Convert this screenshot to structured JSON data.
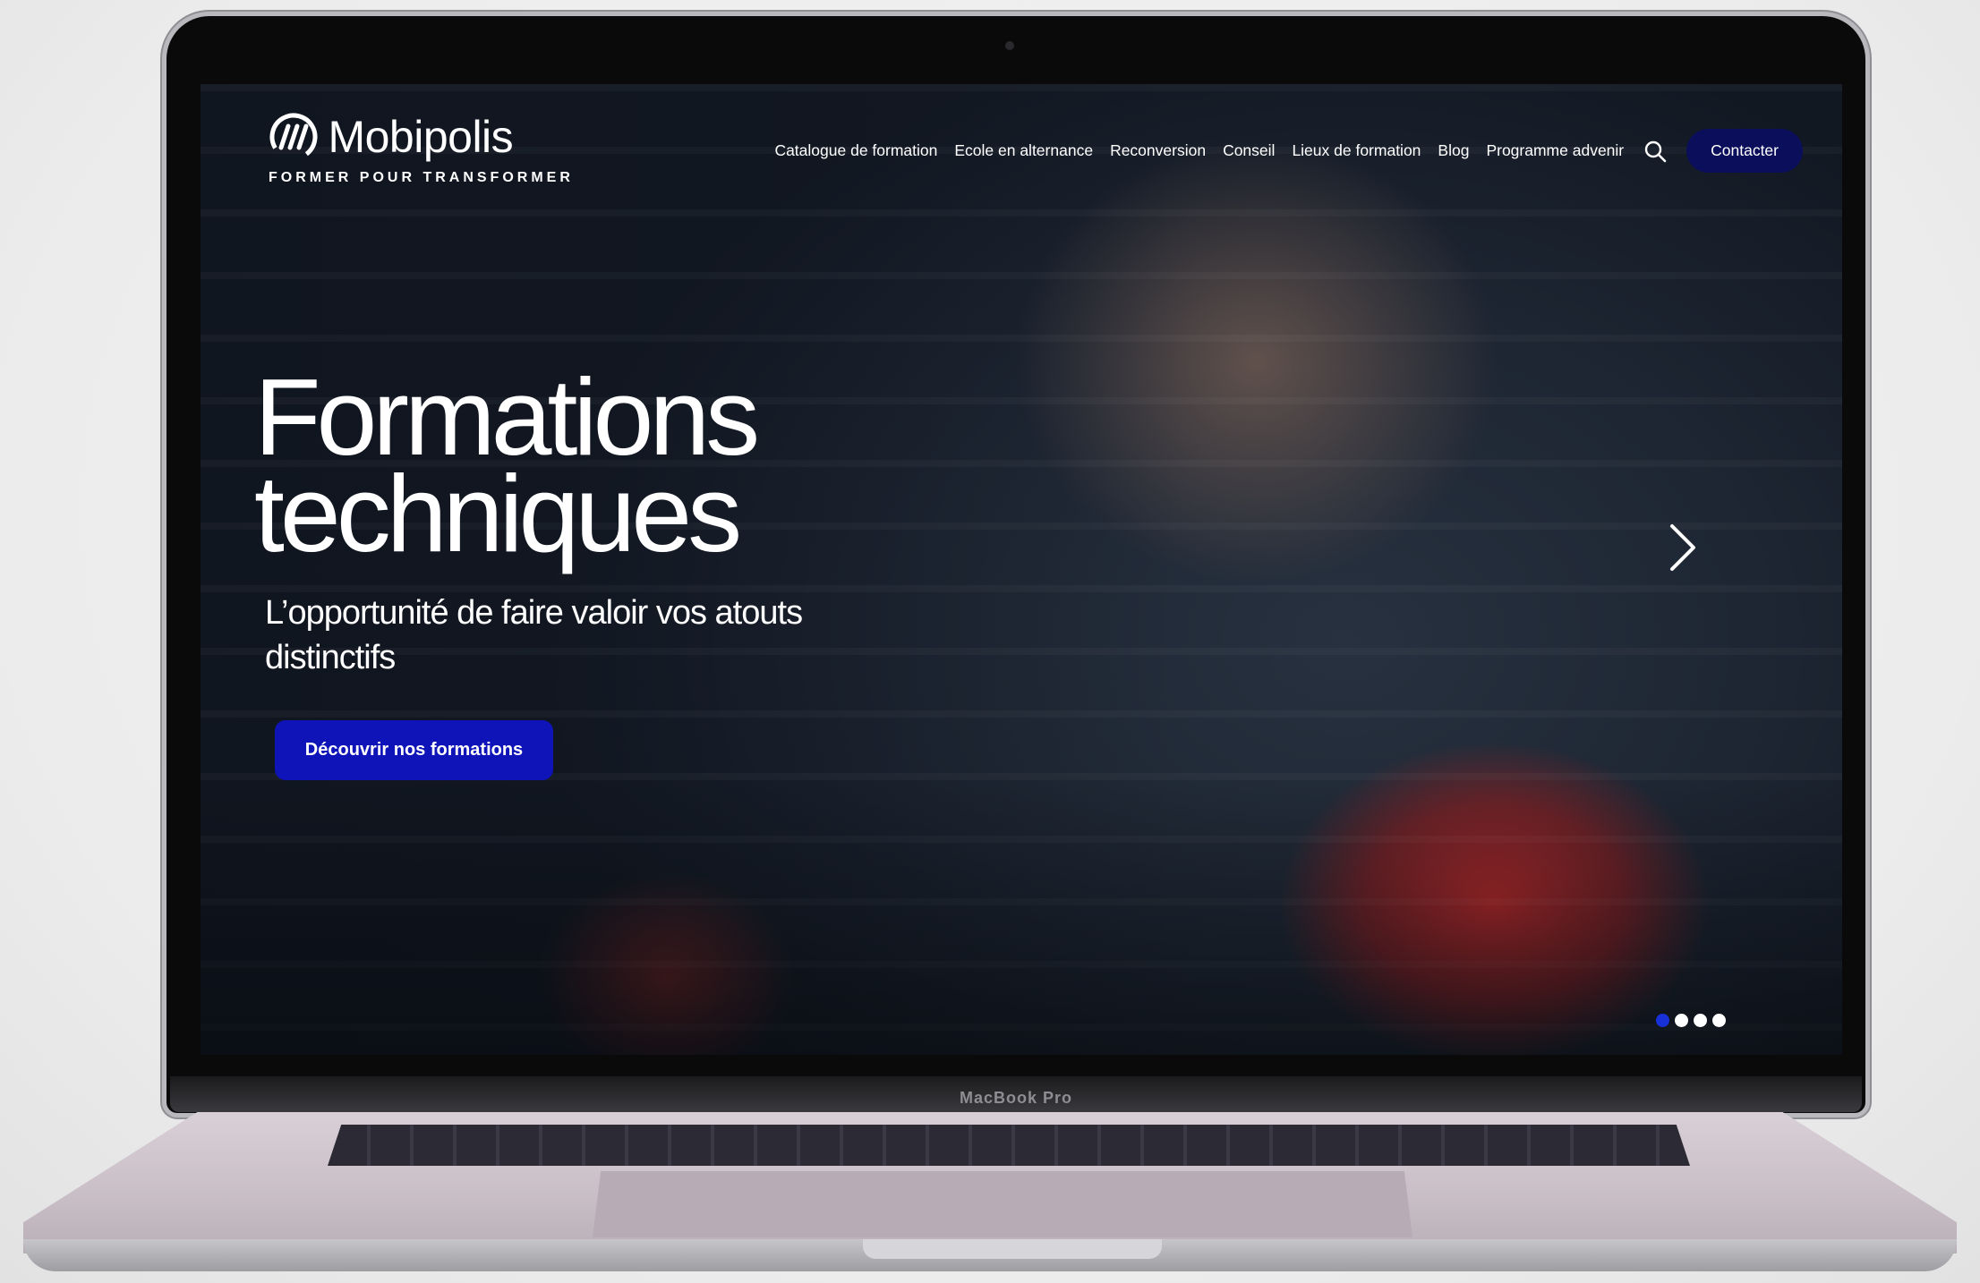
{
  "brand": {
    "name": "Mobipolis",
    "tagline": "FORMER POUR TRANSFORMER"
  },
  "nav": {
    "items": [
      "Catalogue de formation",
      "Ecole en alternance",
      "Reconversion",
      "Conseil",
      "Lieux de formation",
      "Blog",
      "Programme advenir"
    ],
    "contact_label": "Contacter",
    "search_icon": "search-icon"
  },
  "hero": {
    "title_line1": "Formations",
    "title_line2": "techniques",
    "subtitle": "L’opportunité de faire valoir vos atouts distinctifs",
    "cta_label": "Découvrir nos formations",
    "slides_total": 4,
    "active_slide": 1
  },
  "device": {
    "hinge_label": "MacBook Pro"
  },
  "colors": {
    "contact_button": "#0b0e5a",
    "cta_button": "#0f14b8",
    "active_dot": "#1730d8"
  }
}
